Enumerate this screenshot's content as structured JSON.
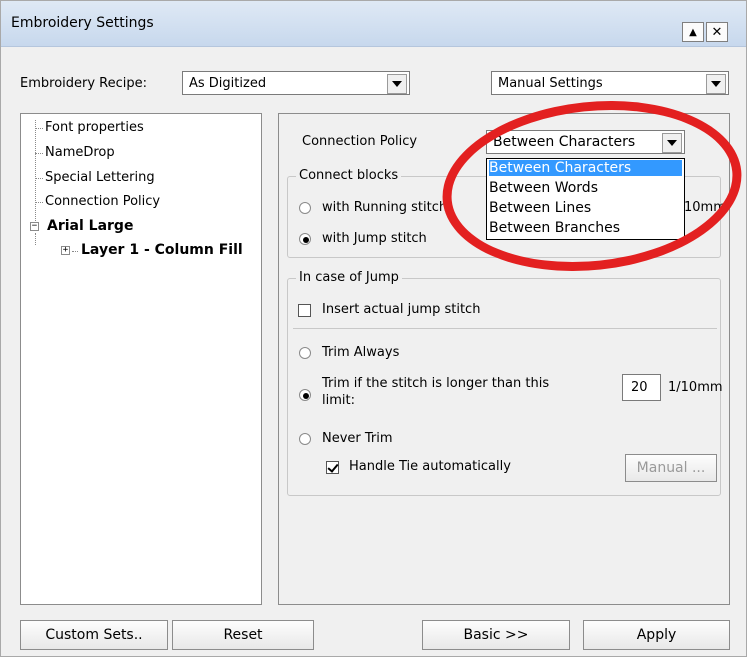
{
  "window": {
    "title": "Embroidery Settings"
  },
  "titlebar_buttons": {
    "up_glyph": "▲",
    "close_glyph": "✕"
  },
  "recipe": {
    "label": "Embroidery Recipe:",
    "value": "As Digitized"
  },
  "settings_mode": {
    "value": "Manual Settings"
  },
  "tree": {
    "items": [
      "Font properties",
      "NameDrop",
      "Special Lettering",
      "Connection Policy"
    ],
    "font_node": "Arial Large",
    "layer_node": "Layer 1 - Column Fill"
  },
  "connection_policy": {
    "label": "Connection Policy",
    "value": "Between Characters",
    "options": [
      "Between Characters",
      "Between Words",
      "Between Lines",
      "Between Branches"
    ]
  },
  "connect_blocks": {
    "legend": "Connect blocks",
    "running": "with Running stitch",
    "jump": "with Jump stitch",
    "unit_partial": "10mm"
  },
  "jump_case": {
    "legend": "In case of Jump",
    "insert_actual": "Insert actual jump stitch",
    "trim_always": "Trim Always",
    "trim_if_line1": "Trim if the stitch is longer than this",
    "trim_if_line2": "limit:",
    "limit_value": "20",
    "limit_unit": "1/10mm",
    "never_trim": "Never Trim",
    "handle_tie": "Handle Tie automatically",
    "manual_button": "Manual ..."
  },
  "footer": {
    "custom_sets": "Custom Sets..",
    "reset": "Reset",
    "basic": "Basic >>",
    "apply": "Apply"
  },
  "colors": {
    "selection": "#3399ff",
    "annotation": "#e32020"
  }
}
